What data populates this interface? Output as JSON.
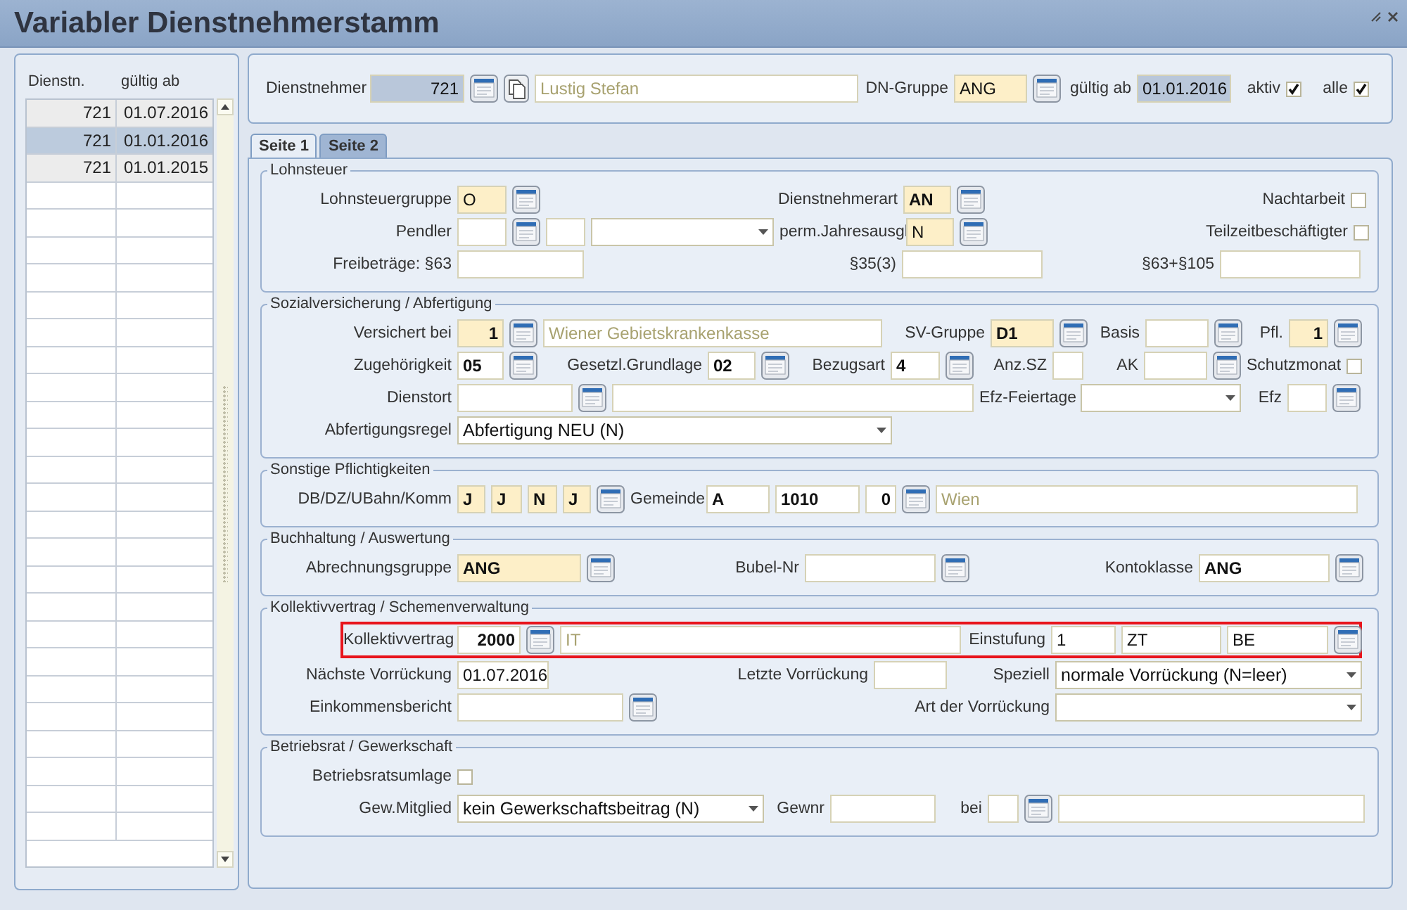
{
  "window": {
    "title": "Variabler Dienstnehmerstamm"
  },
  "list": {
    "columns": [
      "Dienstn.",
      "gültig ab"
    ],
    "rows": [
      {
        "cells": [
          "721",
          "01.07.2016"
        ],
        "selected": false
      },
      {
        "cells": [
          "721",
          "01.01.2016"
        ],
        "selected": true
      },
      {
        "cells": [
          "721",
          "01.01.2015"
        ],
        "selected": false
      }
    ]
  },
  "header": {
    "items": [
      {
        "kind": "label",
        "text": "Dienstnehmer"
      },
      {
        "kind": "field",
        "value": "721",
        "readonly": true
      },
      {
        "kind": "lookup"
      },
      {
        "kind": "copy"
      },
      {
        "kind": "display",
        "value": "Lustig Stefan"
      },
      {
        "kind": "label",
        "text": "DN-Gruppe"
      },
      {
        "kind": "field",
        "value": "ANG",
        "required": true
      },
      {
        "kind": "lookup"
      },
      {
        "kind": "label",
        "text": "gültig ab"
      },
      {
        "kind": "field",
        "value": "01.01.2016",
        "readonly": true
      },
      {
        "kind": "label",
        "text": "aktiv"
      },
      {
        "kind": "checkbox",
        "checked": true
      },
      {
        "kind": "label",
        "text": "alle"
      },
      {
        "kind": "checkbox",
        "checked": true
      }
    ]
  },
  "tabs": [
    {
      "label": "Seite 1",
      "selected": true
    },
    {
      "label": "Seite 2",
      "selected": false
    }
  ],
  "sections": [
    {
      "title": "Lohnsteuer",
      "rows": [
        {
          "items": [
            {
              "kind": "label",
              "text": "Lohnsteuergruppe"
            },
            {
              "kind": "field",
              "value": "O",
              "required": true
            },
            {
              "kind": "lookup"
            },
            {
              "kind": "label",
              "text": "Dienstnehmerart"
            },
            {
              "kind": "field",
              "value": "AN",
              "required": true,
              "bold": true
            },
            {
              "kind": "lookup"
            },
            {
              "kind": "label",
              "text": "Nachtarbeit"
            },
            {
              "kind": "checkbox",
              "checked": false
            }
          ]
        },
        {
          "items": [
            {
              "kind": "label",
              "text": "Pendler"
            },
            {
              "kind": "field"
            },
            {
              "kind": "lookup"
            },
            {
              "kind": "field"
            },
            {
              "kind": "select"
            },
            {
              "kind": "label",
              "text": "perm.Jahresausgl"
            },
            {
              "kind": "field",
              "value": "N",
              "required": true
            },
            {
              "kind": "lookup"
            },
            {
              "kind": "label",
              "text": "Teilzeitbeschäftigter"
            },
            {
              "kind": "checkbox",
              "checked": false
            }
          ]
        },
        {
          "items": [
            {
              "kind": "label",
              "text": "Freibeträge: §63"
            },
            {
              "kind": "field"
            },
            {
              "kind": "label",
              "text": "§35(3)"
            },
            {
              "kind": "field"
            },
            {
              "kind": "label",
              "text": "§63+§105"
            },
            {
              "kind": "field"
            }
          ]
        }
      ]
    },
    {
      "title": "Sozialversicherung / Abfertigung",
      "rows": [
        {
          "items": [
            {
              "kind": "label",
              "text": "Versichert bei"
            },
            {
              "kind": "field",
              "value": "1",
              "required": true,
              "bold": true
            },
            {
              "kind": "lookup"
            },
            {
              "kind": "display",
              "value": "Wiener Gebietskrankenkasse"
            },
            {
              "kind": "label",
              "text": "SV-Gruppe"
            },
            {
              "kind": "field",
              "value": "D1",
              "required": true,
              "bold": true
            },
            {
              "kind": "lookup"
            },
            {
              "kind": "label",
              "text": "Basis"
            },
            {
              "kind": "field"
            },
            {
              "kind": "lookup"
            },
            {
              "kind": "label",
              "text": "Pfl."
            },
            {
              "kind": "field",
              "value": "1",
              "required": true,
              "bold": true
            },
            {
              "kind": "lookup"
            }
          ]
        },
        {
          "items": [
            {
              "kind": "label",
              "text": "Zugehörigkeit"
            },
            {
              "kind": "field",
              "value": "05",
              "bold": true
            },
            {
              "kind": "lookup"
            },
            {
              "kind": "label",
              "text": "Gesetzl.Grundlage"
            },
            {
              "kind": "field",
              "value": "02",
              "bold": true
            },
            {
              "kind": "lookup"
            },
            {
              "kind": "label",
              "text": "Bezugsart"
            },
            {
              "kind": "field",
              "value": "4",
              "bold": true
            },
            {
              "kind": "lookup"
            },
            {
              "kind": "label",
              "text": "Anz.SZ"
            },
            {
              "kind": "field"
            },
            {
              "kind": "label",
              "text": "AK"
            },
            {
              "kind": "field"
            },
            {
              "kind": "lookup"
            },
            {
              "kind": "label",
              "text": "Schutzmonat"
            },
            {
              "kind": "checkbox",
              "checked": false
            }
          ]
        },
        {
          "items": [
            {
              "kind": "label",
              "text": "Dienstort"
            },
            {
              "kind": "field"
            },
            {
              "kind": "lookup"
            },
            {
              "kind": "field"
            },
            {
              "kind": "label",
              "text": "Efz-Feiertage"
            },
            {
              "kind": "select"
            },
            {
              "kind": "label",
              "text": "Efz"
            },
            {
              "kind": "field"
            },
            {
              "kind": "lookup"
            }
          ]
        },
        {
          "items": [
            {
              "kind": "label",
              "text": "Abfertigungsregel"
            },
            {
              "kind": "select",
              "value": "Abfertigung NEU (N)"
            }
          ]
        }
      ]
    },
    {
      "title": "Sonstige Pflichtigkeiten",
      "rows": [
        {
          "items": [
            {
              "kind": "label",
              "text": "DB/DZ/UBahn/Komm"
            },
            {
              "kind": "field",
              "value": "J",
              "required": true,
              "bold": true
            },
            {
              "kind": "field",
              "value": "J",
              "required": true,
              "bold": true
            },
            {
              "kind": "field",
              "value": "N",
              "required": true,
              "bold": true
            },
            {
              "kind": "field",
              "value": "J",
              "required": true,
              "bold": true
            },
            {
              "kind": "lookup"
            },
            {
              "kind": "label",
              "text": "Gemeinde"
            },
            {
              "kind": "field",
              "value": "A",
              "bold": true
            },
            {
              "kind": "field",
              "value": "1010",
              "bold": true
            },
            {
              "kind": "field",
              "value": "0",
              "bold": true
            },
            {
              "kind": "lookup"
            },
            {
              "kind": "display",
              "value": "Wien"
            }
          ]
        }
      ]
    },
    {
      "title": "Buchhaltung / Auswertung",
      "rows": [
        {
          "items": [
            {
              "kind": "label",
              "text": "Abrechnungsgruppe"
            },
            {
              "kind": "field",
              "value": "ANG",
              "required": true,
              "bold": true
            },
            {
              "kind": "lookup"
            },
            {
              "kind": "label",
              "text": "Bubel-Nr"
            },
            {
              "kind": "field"
            },
            {
              "kind": "lookup"
            },
            {
              "kind": "label",
              "text": "Kontoklasse"
            },
            {
              "kind": "field",
              "value": "ANG",
              "bold": true
            },
            {
              "kind": "lookup"
            }
          ]
        }
      ]
    },
    {
      "title": "Kollektivvertrag / Schemenverwaltung",
      "rows": [
        {
          "highlighted": true,
          "items": [
            {
              "kind": "label",
              "text": "Kollektivvertrag"
            },
            {
              "kind": "field",
              "value": "2000",
              "bold": true
            },
            {
              "kind": "lookup"
            },
            {
              "kind": "display",
              "value": "IT"
            },
            {
              "kind": "label",
              "text": "Einstufung"
            },
            {
              "kind": "field",
              "value": "1"
            },
            {
              "kind": "field",
              "value": "ZT"
            },
            {
              "kind": "field",
              "value": "BE"
            },
            {
              "kind": "lookup"
            }
          ]
        },
        {
          "highlighted": false,
          "items": [
            {
              "kind": "label",
              "text": "Nächste Vorrückung"
            },
            {
              "kind": "field",
              "value": "01.07.2016"
            },
            {
              "kind": "label",
              "text": "Letzte Vorrückung"
            },
            {
              "kind": "field"
            },
            {
              "kind": "label",
              "text": "Speziell"
            },
            {
              "kind": "select",
              "value": "normale Vorrückung (N=leer)"
            }
          ]
        },
        {
          "highlighted": false,
          "items": [
            {
              "kind": "label",
              "text": "Einkommensbericht"
            },
            {
              "kind": "field"
            },
            {
              "kind": "lookup"
            },
            {
              "kind": "label",
              "text": "Art der Vorrückung"
            },
            {
              "kind": "select"
            }
          ]
        }
      ]
    },
    {
      "title": "Betriebsrat / Gewerkschaft",
      "rows": [
        {
          "items": [
            {
              "kind": "label",
              "text": "Betriebsratsumlage"
            },
            {
              "kind": "checkbox",
              "checked": false
            }
          ]
        },
        {
          "items": [
            {
              "kind": "label",
              "text": "Gew.Mitglied"
            },
            {
              "kind": "select",
              "value": "kein Gewerkschaftsbeitrag (N)"
            },
            {
              "kind": "label",
              "text": "Gewnr"
            },
            {
              "kind": "field"
            },
            {
              "kind": "label",
              "text": "bei"
            },
            {
              "kind": "field"
            },
            {
              "kind": "lookup"
            },
            {
              "kind": "field"
            }
          ]
        }
      ]
    }
  ]
}
